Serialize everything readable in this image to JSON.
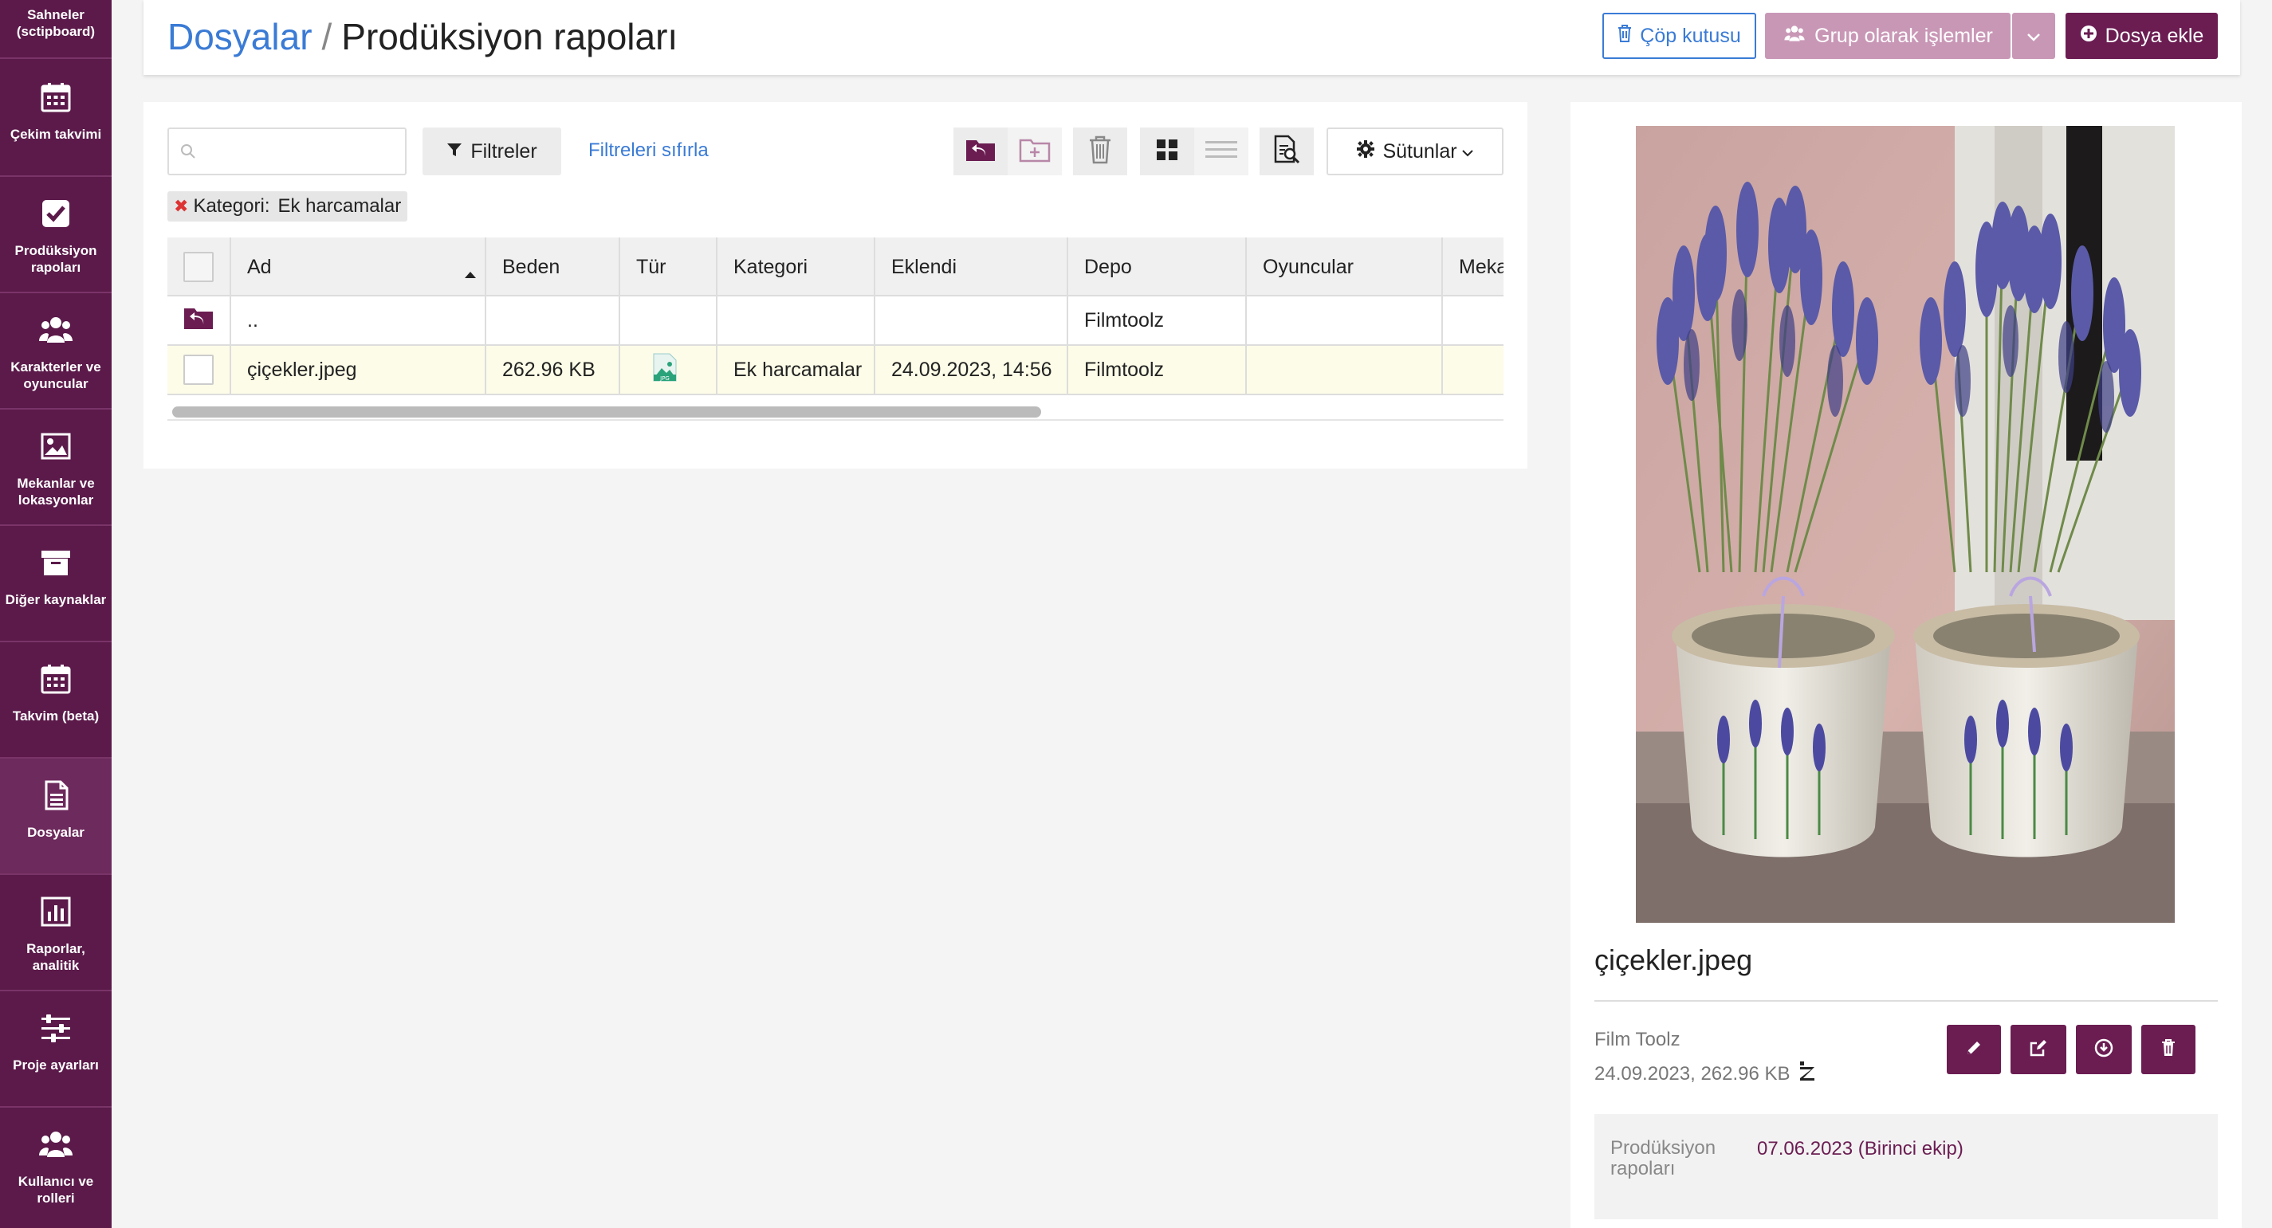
{
  "sidebar": {
    "top_label": "Sahneler (sctipboard)",
    "items": [
      {
        "label": "Çekim takvimi",
        "icon": "calendar-icon"
      },
      {
        "label": "Prodüksiyon rapoları",
        "icon": "check-square-icon"
      },
      {
        "label": "Karakterler ve oyuncular",
        "icon": "users-icon"
      },
      {
        "label": "Mekanlar ve lokasyonlar",
        "icon": "image-icon"
      },
      {
        "label": "Diğer kaynaklar",
        "icon": "archive-icon"
      },
      {
        "label": "Takvim (beta)",
        "icon": "calendar-icon"
      },
      {
        "label": "Dosyalar",
        "icon": "file-icon"
      },
      {
        "label": "Raporlar, analitik",
        "icon": "bar-chart-icon"
      },
      {
        "label": "Proje ayarları",
        "icon": "sliders-icon"
      },
      {
        "label": "Kullanıcı ve rolleri",
        "icon": "users-icon"
      }
    ],
    "active_index": 6
  },
  "header": {
    "breadcrumb_root": "Dosyalar",
    "breadcrumb_sep": "/",
    "breadcrumb_current": "Prodüksiyon rapoları",
    "trash_label": "Çöp kutusu",
    "group_label": "Grup olarak işlemler",
    "add_label": "Dosya ekle"
  },
  "toolbar": {
    "search_placeholder": "",
    "filters_label": "Filtreler",
    "reset_label": "Filtreleri sıfırla",
    "columns_label": "Sütunlar"
  },
  "filter_chip": {
    "label": "Kategori:",
    "value": "Ek harcamalar"
  },
  "table": {
    "columns": [
      "Ad",
      "Beden",
      "Tür",
      "Kategori",
      "Eklendi",
      "Depo",
      "Oyuncular",
      "Meka"
    ],
    "parent_row": {
      "name": "..",
      "depo": "Filmtoolz"
    },
    "rows": [
      {
        "name": "çiçekler.jpeg",
        "size": "262.96 KB",
        "type": "JPG",
        "category": "Ek harcamalar",
        "added": "24.09.2023, 14:56",
        "depo": "Filmtoolz",
        "actors": "",
        "place": ""
      }
    ]
  },
  "preview": {
    "file_name": "çiçekler.jpeg",
    "owner": "Film Toolz",
    "meta": "24.09.2023, 262.96 KB",
    "info_label": "Prodüksiyon rapoları",
    "info_value": "07.06.2023 (Birinci ekip)"
  },
  "colors": {
    "sidebar": "#5b1a4a",
    "primary": "#6b1d52",
    "link": "#3a7bd5",
    "disabled_primary": "#c997b6"
  }
}
